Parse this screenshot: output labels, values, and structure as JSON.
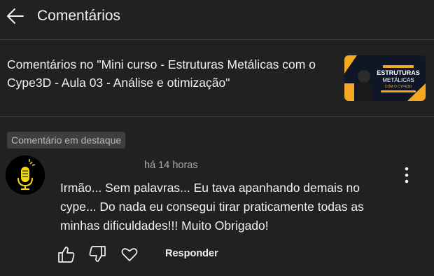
{
  "header": {
    "title": "Comentários",
    "back_icon": "arrow-left-icon"
  },
  "video": {
    "title": "Comentários no \"Mini curso - Estruturas Metálicas com o Cype3D - Aula 03 - Análise e otimização\"",
    "thumbnail": {
      "line1": "ESTRUTURAS",
      "line2": "METÁLICAS",
      "line3": "COM O CYPE3D"
    }
  },
  "comment": {
    "badge": "Comentário em destaque",
    "time": "há 14 horas",
    "text": "Irmão... Sem palavras... Eu tava apanhando demais no cype... Do nada eu consegui tirar praticamente todas as minhas dificuldades!!! Muito Obrigado!",
    "avatar_icon": "microphone-icon",
    "menu_icon": "more-vertical-icon",
    "actions": {
      "like_icon": "thumbs-up-icon",
      "dislike_icon": "thumbs-down-icon",
      "heart_icon": "heart-icon",
      "reply_label": "Responder"
    }
  },
  "colors": {
    "background": "#212121",
    "text": "#f1f1f1",
    "muted": "#aaaaaa",
    "badge_bg": "#3f3f3f",
    "thumb_accent": "#f5a623"
  }
}
